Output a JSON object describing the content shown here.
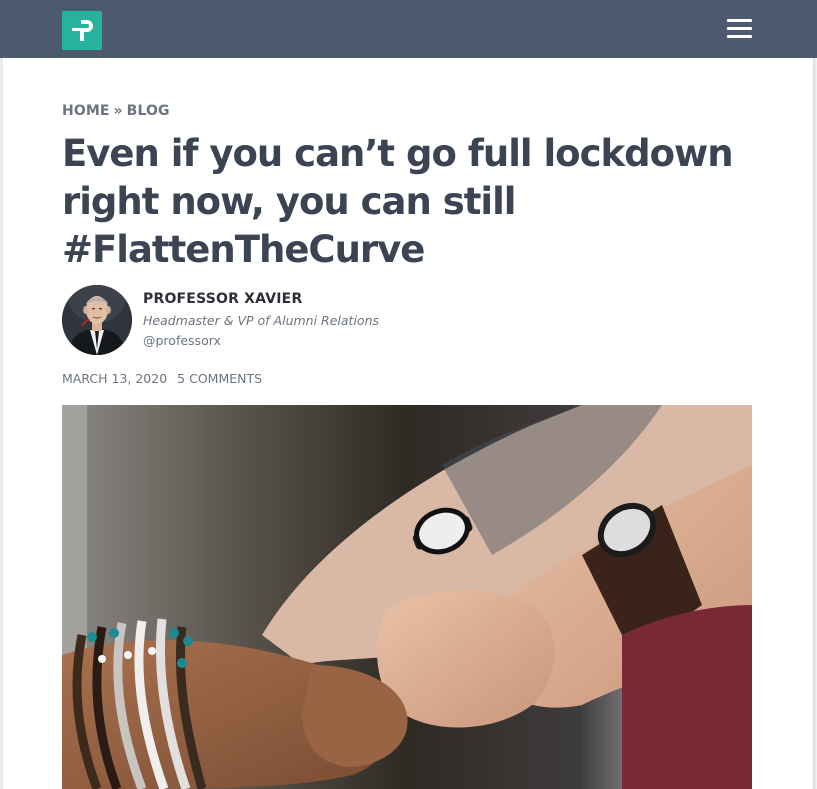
{
  "header": {
    "logo_icon": "plus-p-logo-icon",
    "logo_color": "#26b39d",
    "background_color": "#4d5a6e",
    "menu_icon": "hamburger-menu-icon"
  },
  "breadcrumb": {
    "home": "HOME",
    "separator": "»",
    "blog": "BLOG"
  },
  "article": {
    "title_line1": "Even if you can’t go full lockdown",
    "title_line2": "right now, you can still",
    "title_line3": "#FlattenTheCurve",
    "author": {
      "name": "PROFESSOR XAVIER",
      "role": "Headmaster & VP of Alumni Relations",
      "handle": "@professorx"
    },
    "date": "MARCH 13, 2020",
    "comments": "5 COMMENTS",
    "hero_image_subject": "fist-bump-hands-photo"
  }
}
